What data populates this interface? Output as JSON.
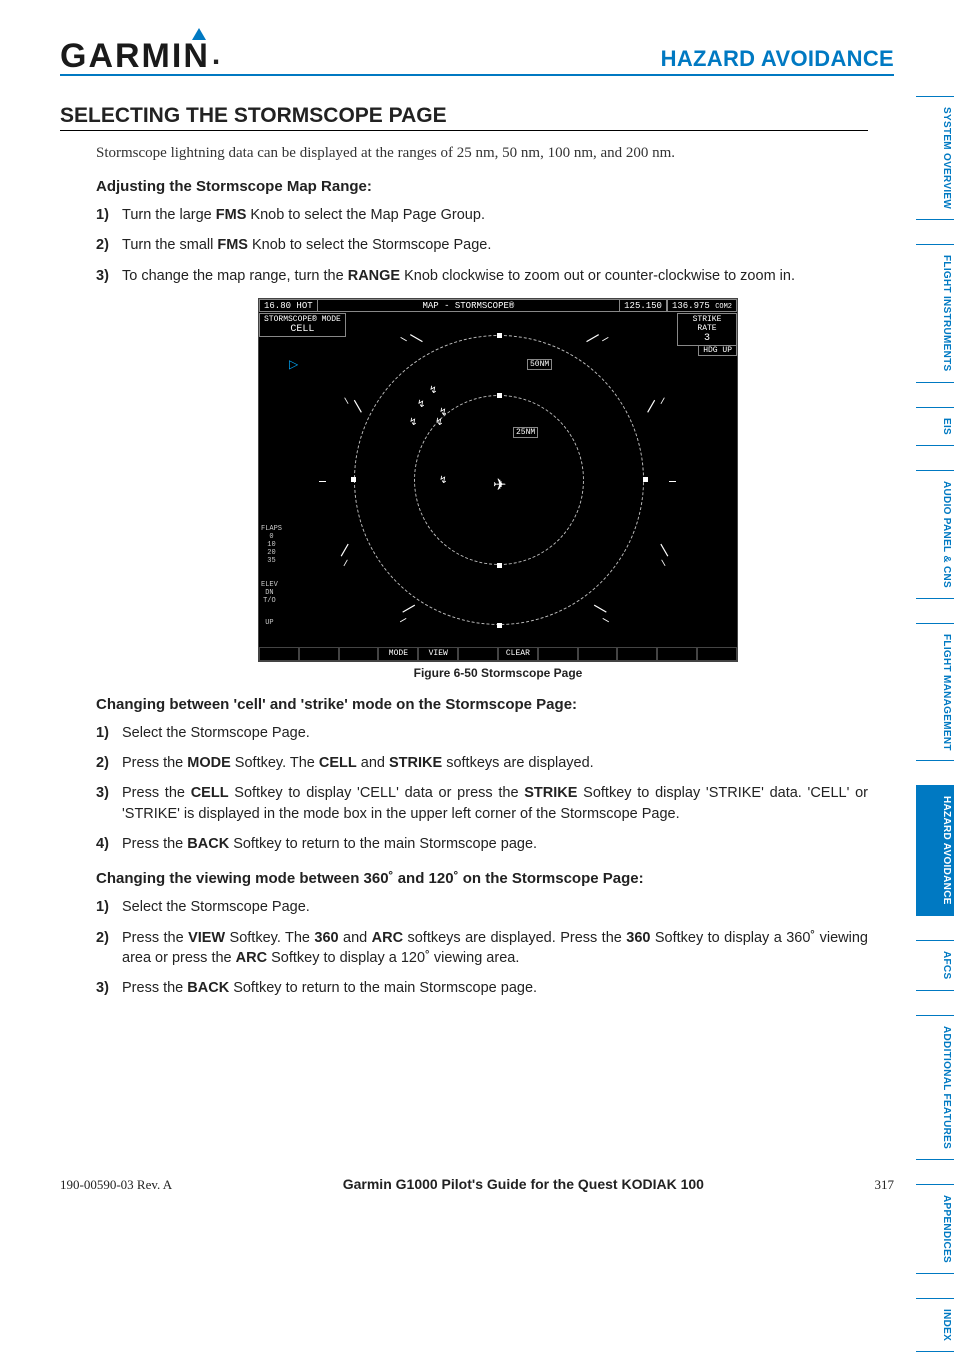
{
  "header": {
    "brand": "GARMIN",
    "title": "HAZARD AVOIDANCE"
  },
  "section_title": "SELECTING THE STORMSCOPE PAGE",
  "intro": "Stormscope lightning data can be displayed at the ranges of 25 nm, 50 nm, 100 nm, and 200 nm.",
  "sub1": "Adjusting the Stormscope Map Range:",
  "steps1": {
    "s1a": "Turn the large ",
    "s1b": "FMS",
    "s1c": " Knob to select the Map Page Group.",
    "s2a": "Turn the small ",
    "s2b": "FMS",
    "s2c": " Knob to select the Stormscope Page.",
    "s3a": "To change the map range, turn the ",
    "s3b": "RANGE",
    "s3c": " Knob clockwise to zoom out or counter-clockwise to zoom in."
  },
  "figure": {
    "caption": "Figure 6-50  Stormscope Page",
    "top_left_freq": "16.80",
    "top_left_label": "HOT",
    "top_center": "MAP - STORMSCOPE®",
    "top_freq1": "125.150",
    "top_freq2": "136.975",
    "top_com": "COM2",
    "mode_label": "STORMSCOPE® MODE",
    "mode_value": "CELL",
    "strike_label": "STRIKE RATE",
    "strike_value": "3",
    "hdg": "HDG UP",
    "range_outer": "50NM",
    "range_inner": "25NM",
    "flaps": "FLAPS",
    "flaps_vals": [
      "0",
      "10",
      "20",
      "35"
    ],
    "elev": "ELEV",
    "elev_vals": [
      "DN",
      "T/O",
      "UP"
    ],
    "softkeys": [
      "",
      "",
      "",
      "MODE",
      "VIEW",
      "",
      "CLEAR",
      "",
      "",
      "",
      "",
      ""
    ]
  },
  "sub2": "Changing between 'cell' and 'strike' mode on the Stormscope Page:",
  "steps2": {
    "s1": "Select the Stormscope Page.",
    "s2a": "Press the ",
    "s2b": "MODE",
    "s2c": " Softkey.  The ",
    "s2d": "CELL",
    "s2e": " and ",
    "s2f": "STRIKE",
    "s2g": " softkeys are displayed.",
    "s3a": "Press the ",
    "s3b": "CELL",
    "s3c": " Softkey to display 'CELL' data or press the ",
    "s3d": "STRIKE",
    "s3e": " Softkey to display 'STRIKE' data.  'CELL' or 'STRIKE' is displayed in the mode box in the upper left corner of the Stormscope Page.",
    "s4a": "Press the ",
    "s4b": "BACK",
    "s4c": " Softkey to return to the main Stormscope page."
  },
  "sub3": "Changing the viewing mode between 360˚ and 120˚ on the Stormscope Page:",
  "steps3": {
    "s1": "Select the Stormscope Page.",
    "s2a": "Press the ",
    "s2b": "VIEW",
    "s2c": " Softkey.  The ",
    "s2d": "360",
    "s2e": " and ",
    "s2f": "ARC",
    "s2g": " softkeys are displayed.  Press the ",
    "s2h": "360",
    "s2i": " Softkey to display a 360˚ viewing area or press the ",
    "s2j": "ARC",
    "s2k": " Softkey to display a 120˚ viewing area.",
    "s3a": "Press the ",
    "s3b": "BACK",
    "s3c": " Softkey to return to the main Stormscope page."
  },
  "tabs": [
    "SYSTEM OVERVIEW",
    "FLIGHT INSTRUMENTS",
    "EIS",
    "AUDIO PANEL & CNS",
    "FLIGHT MANAGEMENT",
    "HAZARD AVOIDANCE",
    "AFCS",
    "ADDITIONAL FEATURES",
    "APPENDICES",
    "INDEX"
  ],
  "active_tab_index": 5,
  "footer": {
    "left": "190-00590-03  Rev. A",
    "center": "Garmin G1000 Pilot's Guide for the Quest KODIAK 100",
    "right": "317"
  }
}
